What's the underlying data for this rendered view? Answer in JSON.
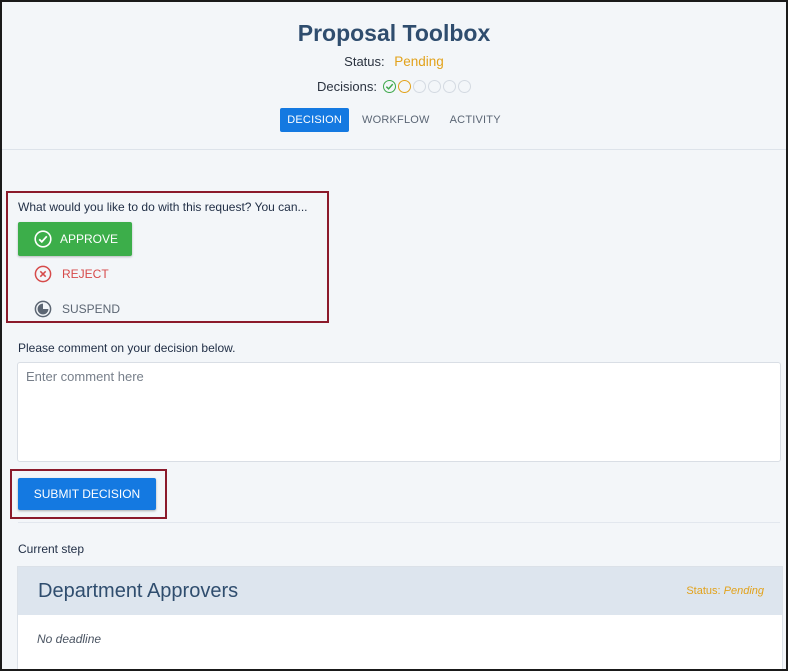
{
  "header": {
    "title": "Proposal Toolbox",
    "status_label": "Status:",
    "status_value": "Pending",
    "decisions_label": "Decisions:",
    "decision_states": [
      "approved",
      "current",
      "empty",
      "empty",
      "empty",
      "empty"
    ]
  },
  "tabs": [
    {
      "label": "DECISION",
      "active": true
    },
    {
      "label": "WORKFLOW",
      "active": false
    },
    {
      "label": "ACTIVITY",
      "active": false
    }
  ],
  "decision": {
    "prompt": "What would you like to do with this request? You can...",
    "approve_label": "APPROVE",
    "reject_label": "REJECT",
    "suspend_label": "SUSPEND"
  },
  "comment": {
    "label": "Please comment on your decision below.",
    "placeholder": "Enter comment here",
    "value": ""
  },
  "submit_label": "SUBMIT DECISION",
  "current_step": {
    "label": "Current step",
    "name": "Department Approvers",
    "status_label": "Status:",
    "status_value": "Pending",
    "deadline": "No deadline"
  },
  "colors": {
    "accent": "#1479e1",
    "approve": "#3cae4a",
    "reject": "#d64a4a",
    "pending": "#e2a21b",
    "highlight_border": "#8b1a2b"
  }
}
